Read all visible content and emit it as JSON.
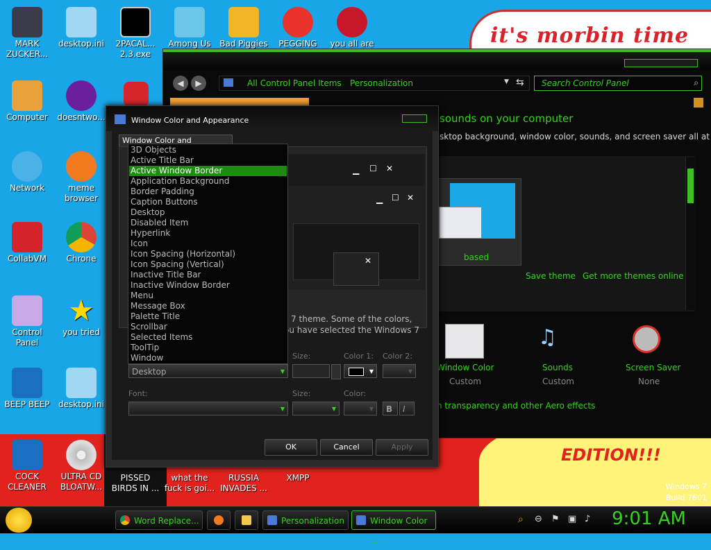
{
  "wallpaper": {
    "banner_text": "it's morbin time",
    "edition_text": "EDITION!!!",
    "os_name": "Windows 7",
    "build": "Build 7601"
  },
  "desktop_icons": [
    {
      "label": "MARK ZUCKER...",
      "icon": "zuckerberg-icon"
    },
    {
      "label": "desktop.ini",
      "icon": "ini-file-icon"
    },
    {
      "label": "2PACAL...\n2.3.exe",
      "icon": "cmd-icon"
    },
    {
      "label": "Among Us",
      "icon": "among-us-icon"
    },
    {
      "label": "Bad Piggies",
      "icon": "bad-piggies-icon"
    },
    {
      "label": "PEGGING",
      "icon": "pegging-icon"
    },
    {
      "label": "you all are",
      "icon": "devcpp-icon"
    },
    {
      "label": "Computer",
      "icon": "computer-icon"
    },
    {
      "label": "doesntwo...",
      "icon": "yahoo-icon"
    },
    {
      "label": "Network",
      "icon": "network-icon"
    },
    {
      "label": "meme browser",
      "icon": "firefox-icon"
    },
    {
      "label": "CollabVM",
      "icon": "recycle-bin-icon"
    },
    {
      "label": "Chrone",
      "icon": "chrome-icon"
    },
    {
      "label": "Control Panel",
      "icon": "control-panel-icon"
    },
    {
      "label": "you tried",
      "icon": "star-icon"
    },
    {
      "label": "BEEP BEEP",
      "icon": "beep-icon"
    },
    {
      "label": "desktop.ini",
      "icon": "ini-file-icon"
    },
    {
      "label": "COCK CLEANER",
      "icon": "cleaner-icon"
    },
    {
      "label": "ULTRA CD BLOATW...",
      "icon": "cd-icon"
    },
    {
      "label": "PISSED BIRDS IN ...",
      "icon": "angry-birds-icon"
    },
    {
      "label": "what the fuck is goi...",
      "icon": "unknown-icon"
    },
    {
      "label": "RUSSIA INVADES ...",
      "icon": "unknown-icon"
    },
    {
      "label": "XMPP",
      "icon": "unknown-icon"
    }
  ],
  "control_panel": {
    "breadcrumb": [
      "All Control Panel Items",
      "Personalization"
    ],
    "search_placeholder": "Search Control Panel",
    "heading": "sounds on your computer",
    "subheading": "sktop background, window color, sounds, and screen saver all at",
    "theme_name": "based",
    "save_theme": "Save theme",
    "get_more_themes": "Get more themes online",
    "bottom_items": [
      {
        "label": "Window Color",
        "sub": "Custom",
        "icon": "window-color-icon"
      },
      {
        "label": "Sounds",
        "sub": "Custom",
        "icon": "sounds-icon"
      },
      {
        "label": "Screen Saver",
        "sub": "None",
        "icon": "screen-saver-icon"
      }
    ],
    "aero_link": "n transparency and other Aero effects"
  },
  "dialog": {
    "title": "Window Color and Appearance",
    "tab": "Window Color and Appearance",
    "info_line1": "s 7 theme.  Some of the colors,",
    "info_line2": "ou have selected the Windows 7",
    "item_label": "Desktop",
    "size_label": "Size:",
    "color1_label": "Color 1:",
    "color2_label": "Color 2:",
    "font_label": "Font:",
    "font_size_label": "Size:",
    "font_color_label": "Color:",
    "bold_label": "B",
    "italic_label": "I",
    "ok": "OK",
    "cancel": "Cancel",
    "apply": "Apply",
    "dropdown_items": [
      "3D Objects",
      "Active Title Bar",
      "Active Window Border",
      "Application Background",
      "Border Padding",
      "Caption Buttons",
      "Desktop",
      "Disabled Item",
      "Hyperlink",
      "Icon",
      "Icon Spacing (Horizontal)",
      "Icon Spacing (Vertical)",
      "Inactive Title Bar",
      "Inactive Window Border",
      "Menu",
      "Message Box",
      "Palette Title",
      "Scrollbar",
      "Selected Items",
      "ToolTip",
      "Window"
    ],
    "selected_item": "Active Window Border"
  },
  "taskbar": {
    "buttons": [
      {
        "label": "Word Replace...",
        "icon": "chrome-icon"
      },
      {
        "label": "",
        "icon": "firefox-icon"
      },
      {
        "label": "",
        "icon": "folder-icon"
      },
      {
        "label": "Personalization",
        "icon": "control-panel-icon"
      },
      {
        "label": "Window Color ...",
        "icon": "control-panel-icon"
      }
    ],
    "clock": "9:01 AM"
  }
}
